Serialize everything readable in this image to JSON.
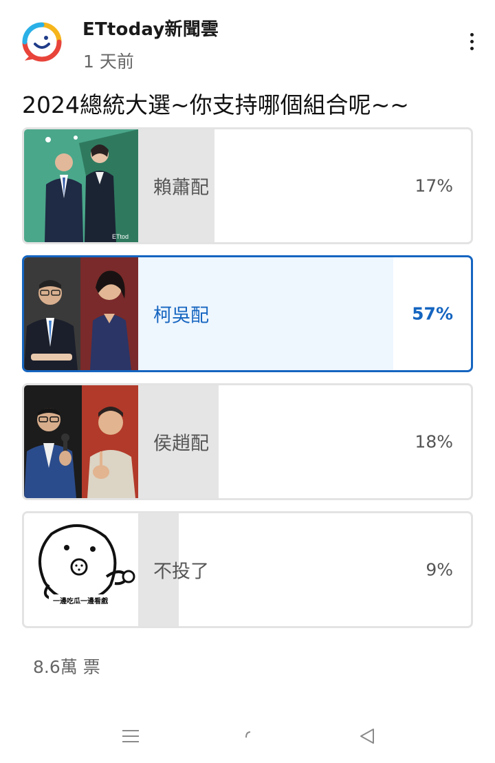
{
  "header": {
    "channel_name": "ETtoday新聞雲",
    "post_time": "1 天前"
  },
  "poll": {
    "question": "2024總統大選~你支持哪個組合呢~~",
    "options": [
      {
        "label": "賴蕭配",
        "percent_text": "17%",
        "percent": 17,
        "selected": false
      },
      {
        "label": "柯吳配",
        "percent_text": "57%",
        "percent": 57,
        "selected": true
      },
      {
        "label": "侯趙配",
        "percent_text": "18%",
        "percent": 18,
        "selected": false
      },
      {
        "label": "不投了",
        "percent_text": "9%",
        "percent": 9,
        "selected": false
      }
    ],
    "vote_count": "8.6萬 票",
    "thumb_caption_1": "ETtod",
    "thumb_caption_4": "一邊吃瓜一邊看戲"
  },
  "colors": {
    "accent": "#1565c0",
    "fill_default": "#e5e5e5",
    "fill_selected": "#eef6fe",
    "border_default": "#e3e3e3"
  },
  "icons": {
    "avatar": "ettoday-logo-icon",
    "more": "more-vertical-icon",
    "nav_recent": "recent-apps-icon",
    "nav_home": "home-icon",
    "nav_back": "back-icon"
  }
}
